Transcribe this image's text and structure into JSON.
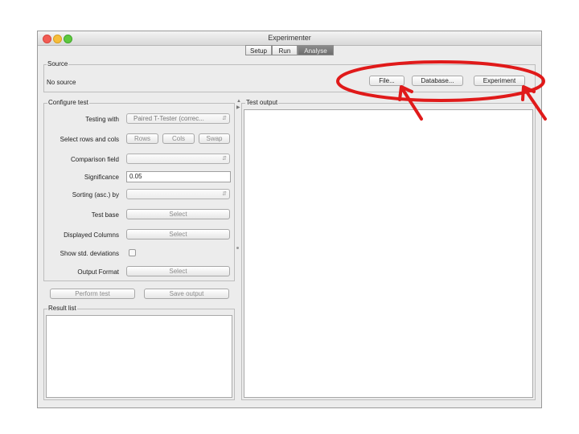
{
  "window": {
    "title": "Experimenter"
  },
  "tabs": [
    {
      "label": "Setup",
      "active": false
    },
    {
      "label": "Run",
      "active": false
    },
    {
      "label": "Analyse",
      "active": true
    }
  ],
  "source": {
    "legend": "Source",
    "status": "No source",
    "file_button": "File...",
    "database_button": "Database...",
    "experiment_button": "Experiment"
  },
  "configure": {
    "legend": "Configure test",
    "testing_with_label": "Testing with",
    "testing_with_value": "Paired T-Tester (correc...",
    "select_rows_cols_label": "Select rows and cols",
    "rows_button": "Rows",
    "cols_button": "Cols",
    "swap_button": "Swap",
    "comparison_field_label": "Comparison field",
    "significance_label": "Significance",
    "significance_value": "0.05",
    "sorting_label": "Sorting (asc.) by",
    "test_base_label": "Test base",
    "test_base_button": "Select",
    "displayed_columns_label": "Displayed Columns",
    "displayed_columns_button": "Select",
    "show_std_label": "Show std. deviations",
    "output_format_label": "Output Format",
    "output_format_button": "Select"
  },
  "actions": {
    "perform_test": "Perform test",
    "save_output": "Save output"
  },
  "result_list": {
    "legend": "Result list"
  },
  "test_output": {
    "legend": "Test output"
  },
  "annotation": {
    "color": "#e01a1a"
  }
}
